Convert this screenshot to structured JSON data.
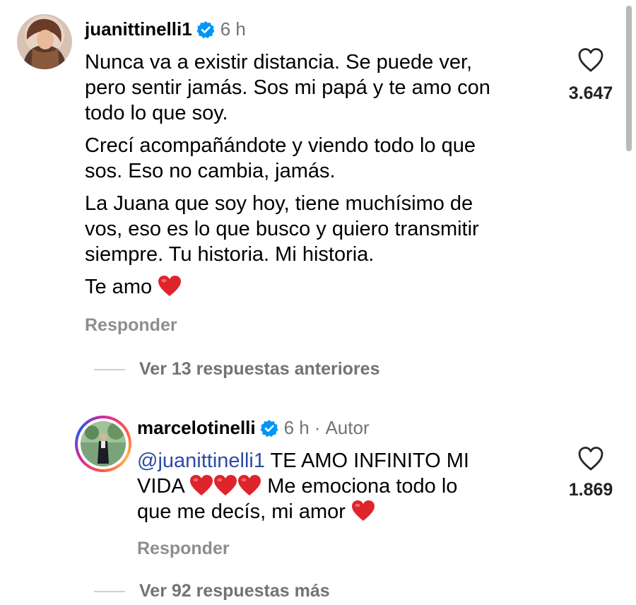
{
  "comments": [
    {
      "username": "juanittinelli1",
      "time": "6 h",
      "paragraphs": [
        [
          "Nunca va a existir distancia. Se puede ver,",
          "pero sentir jamás. Sos mi papá y te amo con",
          "todo lo que soy."
        ],
        [
          "Crecí acompañándote y viendo todo lo que",
          "sos. Eso no cambia, jamás."
        ],
        [
          "La Juana que soy hoy, tiene muchísimo de",
          "vos, eso es lo que busco y quiero  transmitir",
          "siempre. Tu historia. Mi historia."
        ]
      ],
      "last_line": "Te amo",
      "reply_label": "Responder",
      "like_count": "3.647",
      "view_more": "Ver 13 respuestas anteriores"
    },
    {
      "username": "marcelotinelli",
      "time": "6 h",
      "separator": "·",
      "author_label": "Autor",
      "mention": "@juanittinelli1",
      "line1_rest": " TE AMO INFINITO MI",
      "line2_start": "VIDA",
      "line2_end": " Me emociona todo lo",
      "line3": "que me decís, mi amor",
      "reply_label": "Responder",
      "like_count": "1.869",
      "view_more": "Ver 92 respuestas más"
    }
  ],
  "icons": {
    "verified": "verified-badge-icon",
    "like": "heart-outline-icon",
    "emoji": "red-heart-emoji"
  },
  "colors": {
    "verified_blue": "#0095f6",
    "mention_blue": "#2d4ba6",
    "secondary_text": "#737373",
    "heart_red": "#e0242b"
  }
}
